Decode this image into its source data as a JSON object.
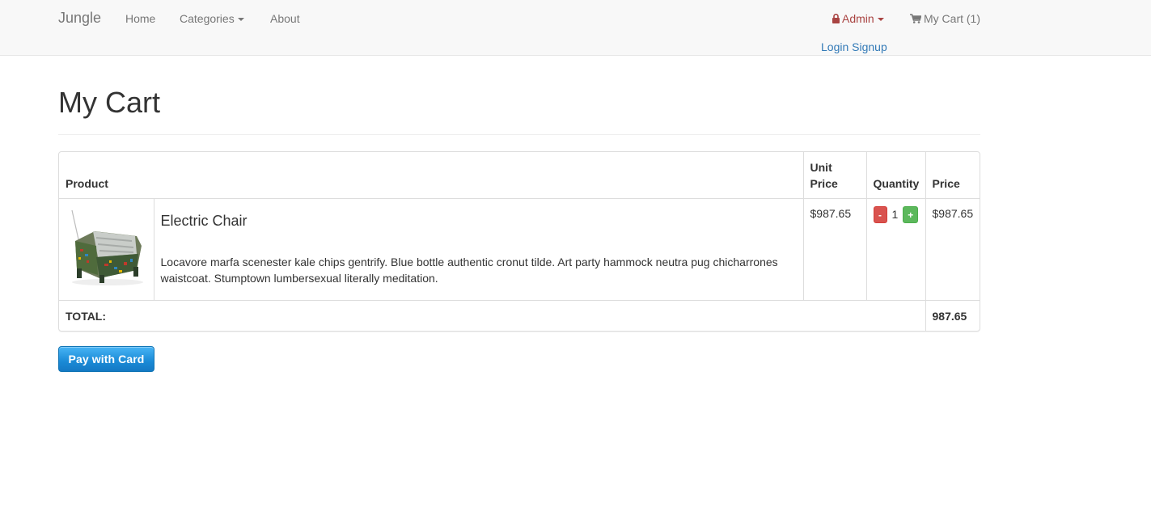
{
  "nav": {
    "brand": "Jungle",
    "home": "Home",
    "categories": "Categories",
    "about": "About",
    "admin": "Admin",
    "cart": "My Cart (1)",
    "login_signup": "Login Signup"
  },
  "page": {
    "title": "My Cart"
  },
  "table": {
    "headers": {
      "product": "Product",
      "unit_price": "Unit Price",
      "quantity": "Quantity",
      "price": "Price"
    },
    "rows": [
      {
        "name": "Electric Chair",
        "description": "Locavore marfa scenester kale chips gentrify. Blue bottle authentic cronut tilde. Art party hammock neutra pug chicharrones waistcoat. Stumptown lumbersexual literally meditation.",
        "unit_price": "$987.65",
        "quantity": "1",
        "minus_label": "-",
        "plus_label": "+",
        "price": "$987.65"
      }
    ],
    "total_label": "TOTAL:",
    "total_value": "987.65"
  },
  "pay_button": "Pay with Card",
  "colors": {
    "link": "#337ab7",
    "admin": "#a94442",
    "minus": "#d9534f",
    "plus": "#5cb85c",
    "pay": "#1a8ad6"
  }
}
